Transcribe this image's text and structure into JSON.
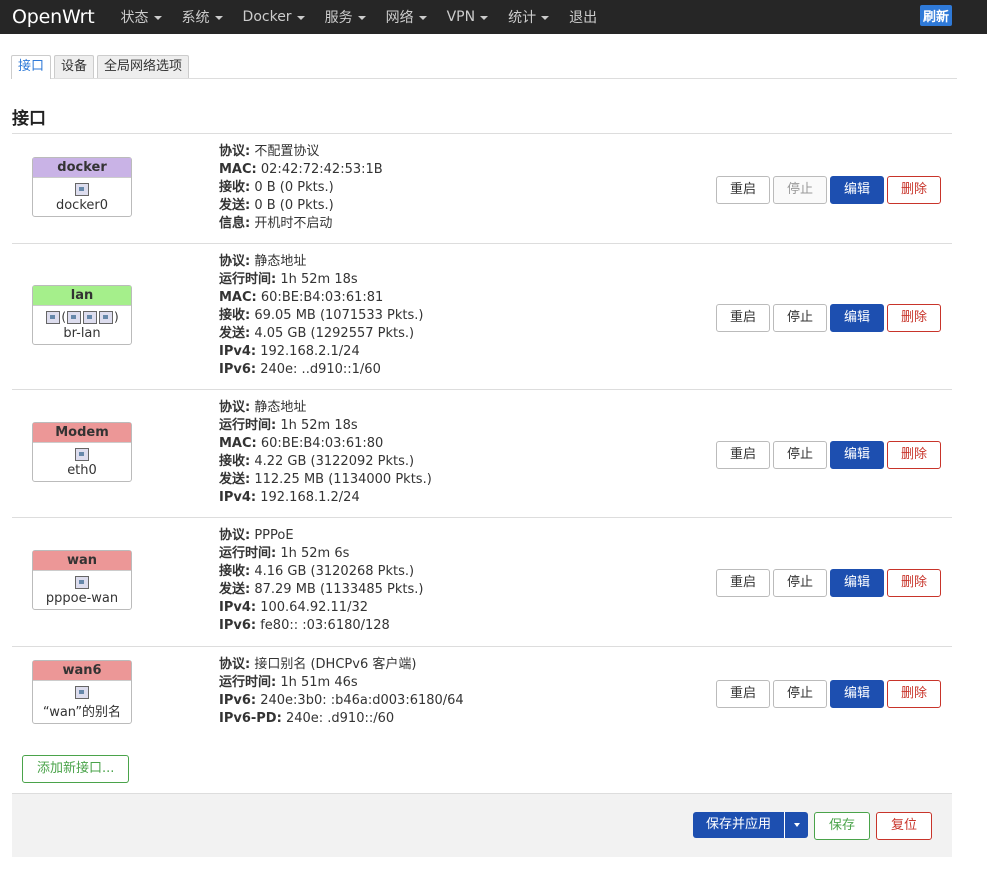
{
  "brand": "OpenWrt",
  "menu": [
    "状态",
    "系统",
    "Docker",
    "服务",
    "网络",
    "VPN",
    "统计",
    "退出"
  ],
  "refresh": "刷新",
  "tabs": [
    "接口",
    "设备",
    "全局网络选项"
  ],
  "section_title": "接口",
  "buttons": {
    "restart": "重启",
    "stop": "停止",
    "edit": "编辑",
    "delete": "删除"
  },
  "add_button": "添加新接口...",
  "footer": {
    "apply": "保存并应用",
    "save": "保存",
    "reset": "复位"
  },
  "colors": {
    "docker": "#c9b3e6",
    "lan": "#a5ef8b",
    "modem": "#ec9797",
    "wan": "#ec9797",
    "wan6": "#ec9797",
    "primary": "#1d4fb0",
    "danger": "#c8342a",
    "success": "#4aa34a"
  },
  "interfaces": [
    {
      "name": "docker",
      "device": "docker0",
      "icons": "single",
      "info": [
        [
          "协议:",
          "不配置协议"
        ],
        [
          "MAC:",
          "02:42:72:42:53:1B"
        ],
        [
          "接收:",
          "0 B (0 Pkts.)"
        ],
        [
          "发送:",
          "0 B (0 Pkts.)"
        ],
        [
          "信息:",
          "开机时不启动"
        ]
      ],
      "stop_disabled": true
    },
    {
      "name": "lan",
      "device": "br-lan",
      "icons": "bridge",
      "info": [
        [
          "协议:",
          "静态地址"
        ],
        [
          "运行时间:",
          "1h 52m 18s"
        ],
        [
          "MAC:",
          "60:BE:B4:03:61:81"
        ],
        [
          "接收:",
          "69.05 MB (1071533 Pkts.)"
        ],
        [
          "发送:",
          "4.05 GB (1292557 Pkts.)"
        ],
        [
          "IPv4:",
          "192.168.2.1/24"
        ],
        [
          "IPv6:",
          "240e:           ..d910::1/60"
        ]
      ],
      "stop_disabled": false
    },
    {
      "name": "Modem",
      "device": "eth0",
      "icons": "single",
      "info": [
        [
          "协议:",
          "静态地址"
        ],
        [
          "运行时间:",
          "1h 52m 18s"
        ],
        [
          "MAC:",
          "60:BE:B4:03:61:80"
        ],
        [
          "接收:",
          "4.22 GB (3122092 Pkts.)"
        ],
        [
          "发送:",
          "112.25 MB (1134000 Pkts.)"
        ],
        [
          "IPv4:",
          "192.168.1.2/24"
        ]
      ],
      "stop_disabled": false
    },
    {
      "name": "wan",
      "device": "pppoe-wan",
      "icons": "single",
      "info": [
        [
          "协议:",
          "PPPoE"
        ],
        [
          "运行时间:",
          "1h 52m 6s"
        ],
        [
          "接收:",
          "4.16 GB (3120268 Pkts.)"
        ],
        [
          "发送:",
          "87.29 MB (1133485 Pkts.)"
        ],
        [
          "IPv4:",
          "100.64.92.11/32"
        ],
        [
          "IPv6:",
          "fe80::                    :03:6180/128"
        ]
      ],
      "stop_disabled": false
    },
    {
      "name": "wan6",
      "device": "“wan”的别名",
      "icons": "single",
      "info": [
        [
          "协议:",
          "接口别名 (DHCPv6 客户端)"
        ],
        [
          "运行时间:",
          "1h 51m 46s"
        ],
        [
          "IPv6:",
          "240e:3b0:                    :b46a:d003:6180/64"
        ],
        [
          "IPv6-PD:",
          "240e:            .d910::/60"
        ]
      ],
      "stop_disabled": false
    }
  ]
}
